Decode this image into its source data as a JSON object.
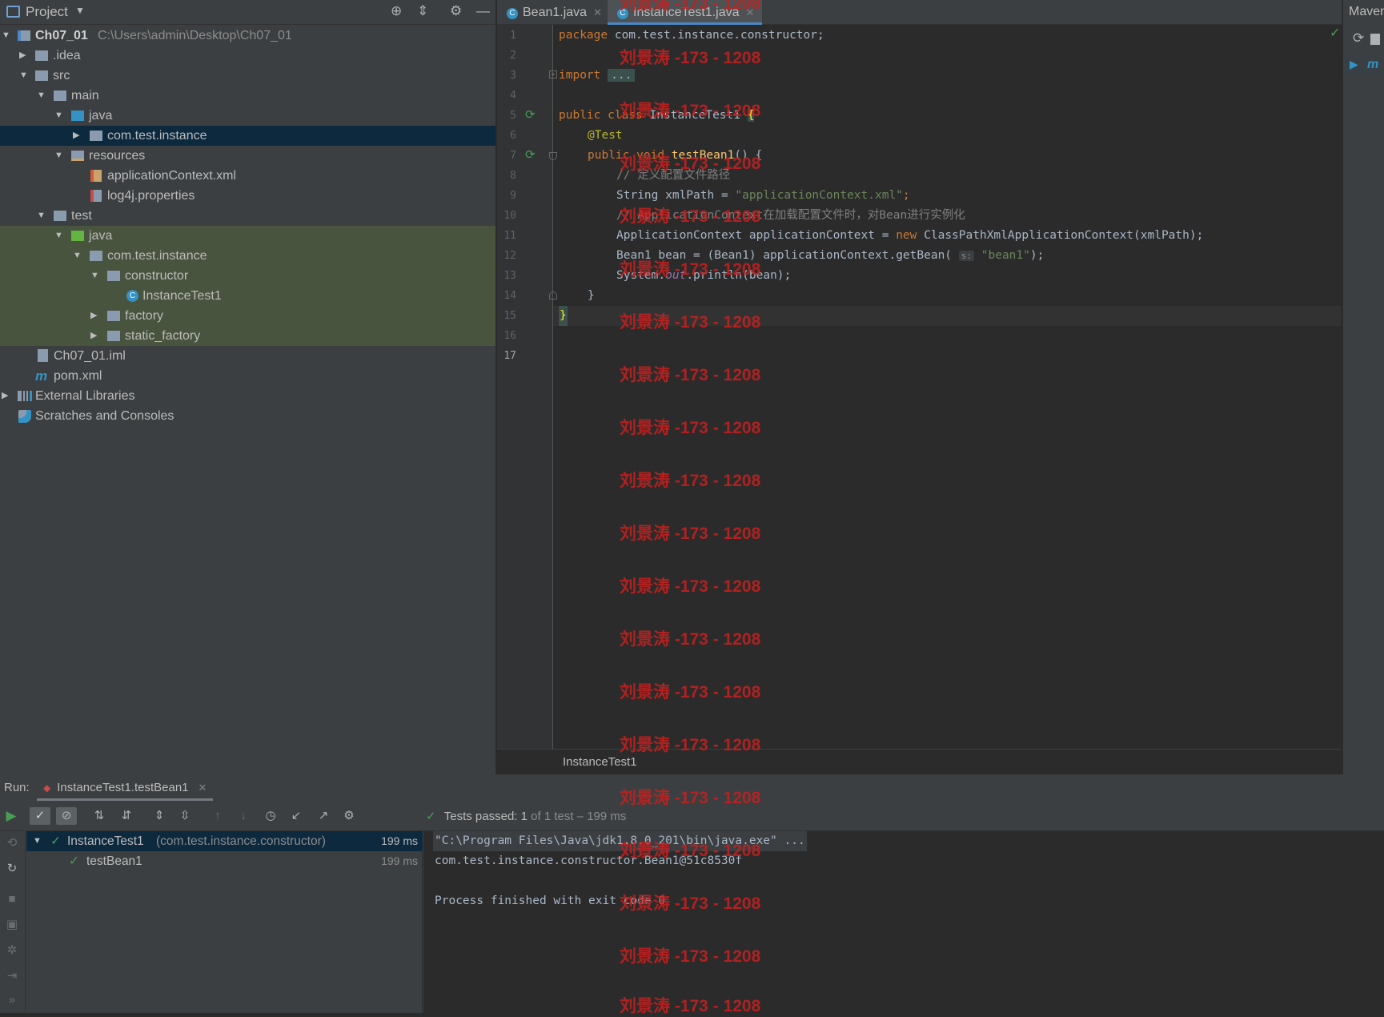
{
  "project_panel": {
    "title": "Project",
    "root": {
      "name": "Ch07_01",
      "path": "C:\\Users\\admin\\Desktop\\Ch07_01"
    },
    "items": [
      {
        "label": ".idea"
      },
      {
        "label": "src"
      },
      {
        "label": "main"
      },
      {
        "label": "java"
      },
      {
        "label": "com.test.instance"
      },
      {
        "label": "resources"
      },
      {
        "label": "applicationContext.xml"
      },
      {
        "label": "log4j.properties"
      },
      {
        "label": "test"
      },
      {
        "label": "java"
      },
      {
        "label": "com.test.instance"
      },
      {
        "label": "constructor"
      },
      {
        "label": "InstanceTest1"
      },
      {
        "label": "factory"
      },
      {
        "label": "static_factory"
      },
      {
        "label": "Ch07_01.iml"
      },
      {
        "label": "pom.xml"
      },
      {
        "label": "External Libraries"
      },
      {
        "label": "Scratches and Consoles"
      }
    ]
  },
  "editor": {
    "tabs": [
      {
        "label": "Bean1.java"
      },
      {
        "label": "InstanceTest1.java"
      }
    ],
    "line_numbers": [
      "1",
      "2",
      "3",
      "4",
      "5",
      "6",
      "7",
      "8",
      "9",
      "10",
      "11",
      "12",
      "13",
      "14",
      "15",
      "16",
      "17"
    ],
    "breadcrumb": "InstanceTest1",
    "code": {
      "l1_kw": "package",
      "l1_rest": " com.test.instance.constructor;",
      "l3_kw": "import",
      "l3_fold": "...",
      "l7_kw1": "public",
      "l7_kw2": "class",
      "l7_name": " InstanceTest1 ",
      "l7_brace": "{",
      "l8": "@Test",
      "l9_kw1": "public",
      "l9_kw2": "void",
      "l9_fn": "testBean1",
      "l9_rest": "() {",
      "l10": "// 定义配置文件路径",
      "l11_type": "String xmlPath = ",
      "l11_str": "\"applicationContext.xml\"",
      "l11_end": ";",
      "l12": "// ApplicationContext在加载配置文件时，对Bean进行实例化",
      "l13_a": "ApplicationContext applicationContext = ",
      "l13_new": "new",
      "l13_b": " ClassPathXmlApplicationContext(xmlPath);",
      "l14_a": "Bean1 bean = (Bean1) applicationContext.getBean(",
      "l14_hint": "s:",
      "l14_str": "\"bean1\"",
      "l14_end": ");",
      "l15_a": "System.",
      "l15_out": "out",
      "l15_b": ".println(bean);",
      "l16": "}",
      "l17": "}"
    }
  },
  "right_panel": {
    "title": "Maven"
  },
  "run": {
    "label": "Run:",
    "tab": "InstanceTest1.testBean1",
    "status_prefix": "Tests passed: ",
    "status_count": "1",
    "status_rest": " of 1 test – 199 ms",
    "tree": [
      {
        "name": "InstanceTest1",
        "detail": "(com.test.instance.constructor)",
        "time": "199 ms"
      },
      {
        "name": "testBean1",
        "time": "199 ms"
      }
    ],
    "console": [
      "\"C:\\Program Files\\Java\\jdk1.8.0_201\\bin\\java.exe\" ...",
      "com.test.instance.constructor.Bean1@51c8530f",
      "",
      "Process finished with exit code 0"
    ]
  },
  "watermark": "刘景涛 -173 - 1208",
  "colors": {
    "selection": "#0d293e",
    "test_source": "#49543f",
    "keyword": "#cc7832",
    "string": "#6a8759",
    "pass": "#499c54",
    "watermark": "#c4201f"
  }
}
